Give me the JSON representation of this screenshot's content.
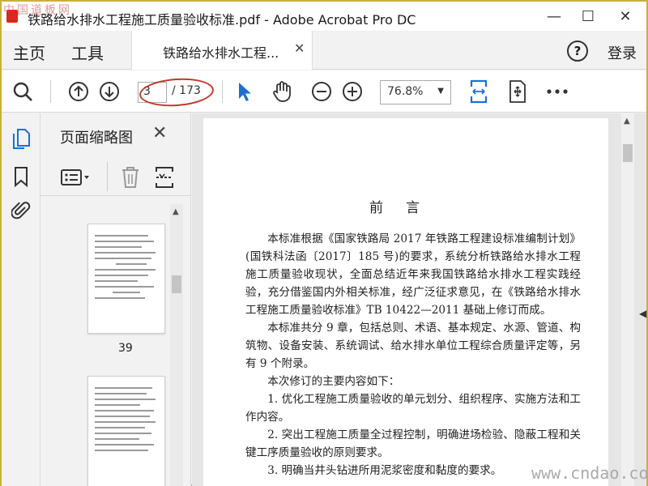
{
  "window": {
    "title": "铁路给水排水工程施工质量验收标准.pdf - Adobe Acrobat Pro DC",
    "minimize": "—",
    "maximize": "☐",
    "close": "✕"
  },
  "watermarks": {
    "top_left": "中国道板网",
    "bottom_right": "www.cndao.com"
  },
  "menu": {
    "home": "主页",
    "tools": "工具",
    "login": "登录",
    "help": "?"
  },
  "tab": {
    "label": "铁路给水排水工程...",
    "close": "✕"
  },
  "toolbar": {
    "current_page": "3",
    "total_pages": "/ 173",
    "zoom": "76.8%",
    "icons": [
      "search-icon",
      "prev-page-icon",
      "next-page-icon",
      "select-cursor-icon",
      "hand-tool-icon",
      "zoom-out-icon",
      "zoom-in-icon",
      "fit-page-icon",
      "scroll-mode-icon",
      "more-icon"
    ]
  },
  "thumbnails": {
    "title": "页面缩略图",
    "close": "✕",
    "page_label": "39"
  },
  "colors": {
    "accent_blue": "#1f6fd1",
    "annotation_red": "#c0392b"
  },
  "document": {
    "heading": "前言",
    "paragraphs": [
      "本标准根据《国家铁路局 2017 年铁路工程建设标准编制计划》(国铁科法函〔2017〕185 号)的要求，系统分析铁路给水排水工程施工质量验收现状，全面总结近年来我国铁路给水排水工程实践经验，充分借鉴国内外相关标准，经广泛征求意见，在《铁路给水排水工程施工质量验收标准》TB 10422—2011 基础上修订而成。",
      "本标准共分 9 章，包括总则、术语、基本规定、水源、管道、构筑物、设备安装、系统调试、给水排水单位工程综合质量评定等，另有 9 个附录。",
      "本次修订的主要内容如下：",
      "1. 优化工程施工质量验收的单元划分、组织程序、实施方法和工作内容。",
      "2. 突出工程施工质量全过程控制，明确进场检验、隐蔽工程和关键工序质量验收的原则要求。",
      "3. 明确当井头钻进所用泥浆密度和黏度的要求。"
    ]
  }
}
